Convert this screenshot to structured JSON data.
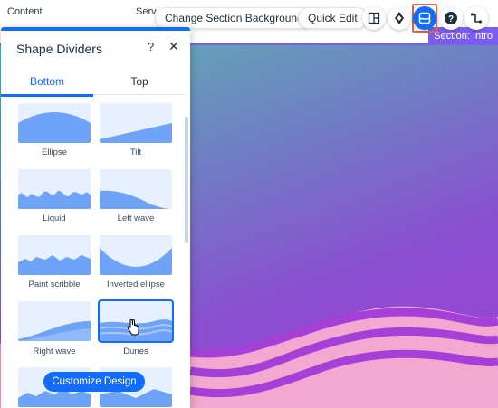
{
  "site": {
    "nav_left": "Content",
    "nav_mid": "Serv"
  },
  "toolbar": {
    "change_bg_label": "Change Section Background",
    "quick_edit_label": "Quick Edit",
    "icons": [
      "layout-icon",
      "animation-icon",
      "dividers-icon",
      "help-icon",
      "connect-icon"
    ]
  },
  "section": {
    "label": "Section: Intro",
    "gradient_colors": [
      "#5fb3b0",
      "#6f7fc4",
      "#8a4fd0",
      "#a041d6"
    ],
    "divider_color": "#f2a8cf"
  },
  "panel": {
    "title": "Shape Dividers",
    "help": "?",
    "close": "✕",
    "tabs": [
      {
        "label": "Bottom",
        "active": true
      },
      {
        "label": "Top",
        "active": false
      }
    ],
    "items": [
      {
        "label": "Ellipse"
      },
      {
        "label": "Tilt"
      },
      {
        "label": "Liquid"
      },
      {
        "label": "Left wave"
      },
      {
        "label": "Paint scribble"
      },
      {
        "label": "Inverted ellipse"
      },
      {
        "label": "Right wave"
      },
      {
        "label": "Dunes",
        "selected": true
      }
    ],
    "customize_label": "Customize Design"
  },
  "colors": {
    "accent": "#116dff",
    "tile_bg": "#e7f0ff",
    "shape": "#6fa3f7",
    "highlight": "#e8604c"
  }
}
